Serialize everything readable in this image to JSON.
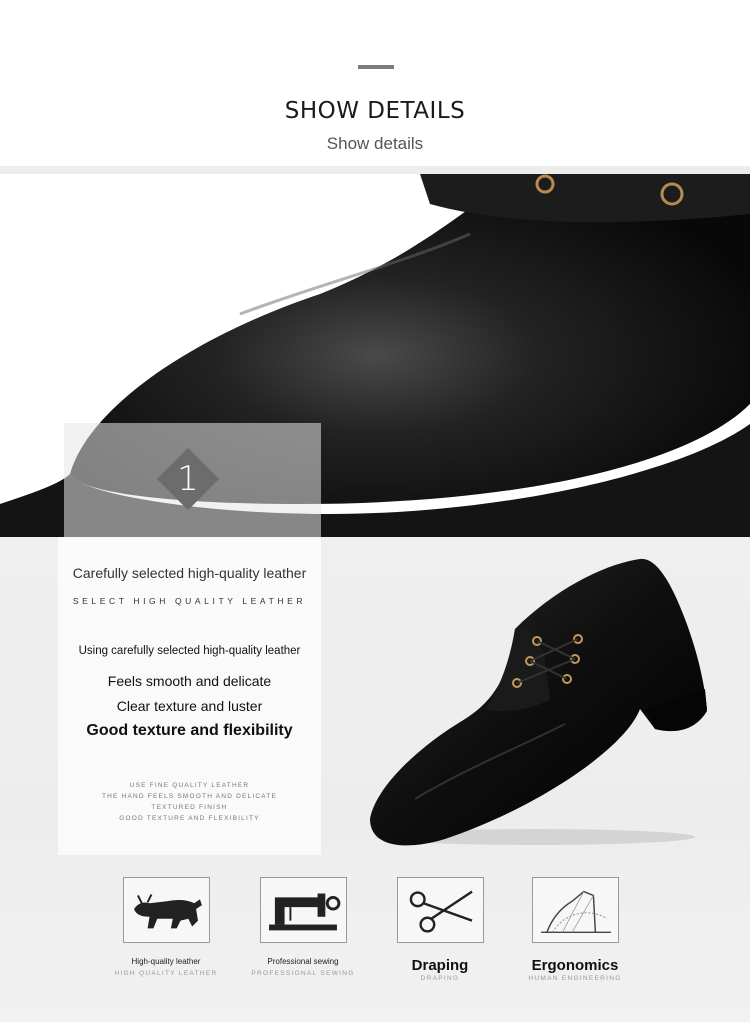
{
  "header": {
    "title": "SHOW DETAILS",
    "subtitle": "Show details"
  },
  "hero": {
    "badge_number": "1"
  },
  "details": {
    "heading": "Carefully selected high-quality leather",
    "subheading": "SELECT HIGH QUALITY LEATHER",
    "line1": "Using carefully selected high-quality leather",
    "line2": "Feels smooth and delicate",
    "line3": "Clear texture and luster",
    "line4": "Good texture and flexibility",
    "small_lines": [
      "USE FINE QUALITY LEATHER",
      "THE HAND FEELS SMOOTH AND DELICATE",
      "TEXTURED FINISH",
      "GOOD TEXTURE AND FLEXIBILITY"
    ]
  },
  "features": [
    {
      "label": "High-quality leather",
      "label_en": "HIGH QUALITY LEATHER",
      "icon": "bull-icon"
    },
    {
      "label": "Professional sewing",
      "label_en": "PROFESSIONAL SEWING",
      "icon": "sewing-machine-icon"
    },
    {
      "label": "Draping",
      "label_en": "DRAPING",
      "icon": "scissors-icon"
    },
    {
      "label": "Ergonomics",
      "label_en": "HUMAN ENGINEERING",
      "icon": "foot-diagram-icon"
    }
  ]
}
